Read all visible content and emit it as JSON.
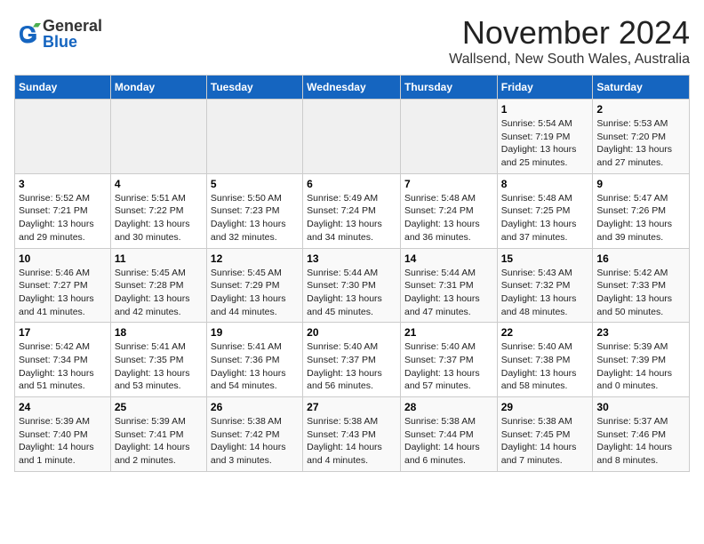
{
  "header": {
    "logo_general": "General",
    "logo_blue": "Blue",
    "month_title": "November 2024",
    "location": "Wallsend, New South Wales, Australia"
  },
  "calendar": {
    "days_of_week": [
      "Sunday",
      "Monday",
      "Tuesday",
      "Wednesday",
      "Thursday",
      "Friday",
      "Saturday"
    ],
    "weeks": [
      [
        {
          "day": "",
          "info": ""
        },
        {
          "day": "",
          "info": ""
        },
        {
          "day": "",
          "info": ""
        },
        {
          "day": "",
          "info": ""
        },
        {
          "day": "",
          "info": ""
        },
        {
          "day": "1",
          "info": "Sunrise: 5:54 AM\nSunset: 7:19 PM\nDaylight: 13 hours\nand 25 minutes."
        },
        {
          "day": "2",
          "info": "Sunrise: 5:53 AM\nSunset: 7:20 PM\nDaylight: 13 hours\nand 27 minutes."
        }
      ],
      [
        {
          "day": "3",
          "info": "Sunrise: 5:52 AM\nSunset: 7:21 PM\nDaylight: 13 hours\nand 29 minutes."
        },
        {
          "day": "4",
          "info": "Sunrise: 5:51 AM\nSunset: 7:22 PM\nDaylight: 13 hours\nand 30 minutes."
        },
        {
          "day": "5",
          "info": "Sunrise: 5:50 AM\nSunset: 7:23 PM\nDaylight: 13 hours\nand 32 minutes."
        },
        {
          "day": "6",
          "info": "Sunrise: 5:49 AM\nSunset: 7:24 PM\nDaylight: 13 hours\nand 34 minutes."
        },
        {
          "day": "7",
          "info": "Sunrise: 5:48 AM\nSunset: 7:24 PM\nDaylight: 13 hours\nand 36 minutes."
        },
        {
          "day": "8",
          "info": "Sunrise: 5:48 AM\nSunset: 7:25 PM\nDaylight: 13 hours\nand 37 minutes."
        },
        {
          "day": "9",
          "info": "Sunrise: 5:47 AM\nSunset: 7:26 PM\nDaylight: 13 hours\nand 39 minutes."
        }
      ],
      [
        {
          "day": "10",
          "info": "Sunrise: 5:46 AM\nSunset: 7:27 PM\nDaylight: 13 hours\nand 41 minutes."
        },
        {
          "day": "11",
          "info": "Sunrise: 5:45 AM\nSunset: 7:28 PM\nDaylight: 13 hours\nand 42 minutes."
        },
        {
          "day": "12",
          "info": "Sunrise: 5:45 AM\nSunset: 7:29 PM\nDaylight: 13 hours\nand 44 minutes."
        },
        {
          "day": "13",
          "info": "Sunrise: 5:44 AM\nSunset: 7:30 PM\nDaylight: 13 hours\nand 45 minutes."
        },
        {
          "day": "14",
          "info": "Sunrise: 5:44 AM\nSunset: 7:31 PM\nDaylight: 13 hours\nand 47 minutes."
        },
        {
          "day": "15",
          "info": "Sunrise: 5:43 AM\nSunset: 7:32 PM\nDaylight: 13 hours\nand 48 minutes."
        },
        {
          "day": "16",
          "info": "Sunrise: 5:42 AM\nSunset: 7:33 PM\nDaylight: 13 hours\nand 50 minutes."
        }
      ],
      [
        {
          "day": "17",
          "info": "Sunrise: 5:42 AM\nSunset: 7:34 PM\nDaylight: 13 hours\nand 51 minutes."
        },
        {
          "day": "18",
          "info": "Sunrise: 5:41 AM\nSunset: 7:35 PM\nDaylight: 13 hours\nand 53 minutes."
        },
        {
          "day": "19",
          "info": "Sunrise: 5:41 AM\nSunset: 7:36 PM\nDaylight: 13 hours\nand 54 minutes."
        },
        {
          "day": "20",
          "info": "Sunrise: 5:40 AM\nSunset: 7:37 PM\nDaylight: 13 hours\nand 56 minutes."
        },
        {
          "day": "21",
          "info": "Sunrise: 5:40 AM\nSunset: 7:37 PM\nDaylight: 13 hours\nand 57 minutes."
        },
        {
          "day": "22",
          "info": "Sunrise: 5:40 AM\nSunset: 7:38 PM\nDaylight: 13 hours\nand 58 minutes."
        },
        {
          "day": "23",
          "info": "Sunrise: 5:39 AM\nSunset: 7:39 PM\nDaylight: 14 hours\nand 0 minutes."
        }
      ],
      [
        {
          "day": "24",
          "info": "Sunrise: 5:39 AM\nSunset: 7:40 PM\nDaylight: 14 hours\nand 1 minute."
        },
        {
          "day": "25",
          "info": "Sunrise: 5:39 AM\nSunset: 7:41 PM\nDaylight: 14 hours\nand 2 minutes."
        },
        {
          "day": "26",
          "info": "Sunrise: 5:38 AM\nSunset: 7:42 PM\nDaylight: 14 hours\nand 3 minutes."
        },
        {
          "day": "27",
          "info": "Sunrise: 5:38 AM\nSunset: 7:43 PM\nDaylight: 14 hours\nand 4 minutes."
        },
        {
          "day": "28",
          "info": "Sunrise: 5:38 AM\nSunset: 7:44 PM\nDaylight: 14 hours\nand 6 minutes."
        },
        {
          "day": "29",
          "info": "Sunrise: 5:38 AM\nSunset: 7:45 PM\nDaylight: 14 hours\nand 7 minutes."
        },
        {
          "day": "30",
          "info": "Sunrise: 5:37 AM\nSunset: 7:46 PM\nDaylight: 14 hours\nand 8 minutes."
        }
      ]
    ]
  }
}
